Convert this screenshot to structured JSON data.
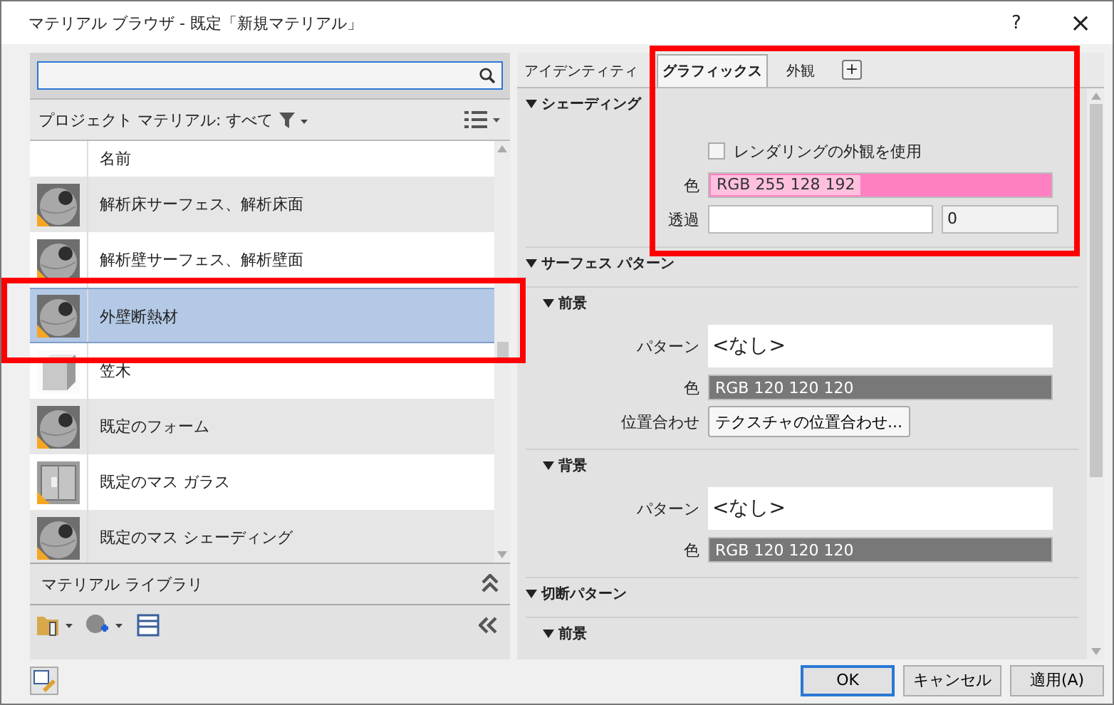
{
  "window": {
    "title": "マテリアル ブラウザ - 既定「新規マテリアル」",
    "help": "?",
    "close": "×"
  },
  "browser": {
    "filter_label": "プロジェクト マテリアル: すべて",
    "column": "名前",
    "rows": [
      {
        "name": "解析床サーフェス、解析床面",
        "kind": "sphere",
        "warning": true,
        "selected": false
      },
      {
        "name": "解析壁サーフェス、解析壁面",
        "kind": "sphere",
        "warning": true,
        "selected": false
      },
      {
        "name": "外壁断熱材",
        "kind": "sphere",
        "warning": true,
        "selected": true
      },
      {
        "name": "笠木",
        "kind": "box",
        "warning": false,
        "selected": false
      },
      {
        "name": "既定のフォーム",
        "kind": "sphere",
        "warning": true,
        "selected": false
      },
      {
        "name": "既定のマス ガラス",
        "kind": "glass",
        "warning": true,
        "selected": false
      },
      {
        "name": "既定のマス シェーディング",
        "kind": "sphere",
        "warning": true,
        "selected": false
      }
    ],
    "library_label": "マテリアル ライブラリ"
  },
  "tabs": [
    {
      "label": "アイデンティティ",
      "selected": false
    },
    {
      "label": "グラフィックス",
      "selected": true
    },
    {
      "label": "外観",
      "selected": false
    }
  ],
  "add_tab": "+",
  "shading": {
    "title": "シェーディング",
    "expanded": true,
    "use_render": {
      "label": "レンダリングの外観を使用",
      "checked": false
    },
    "color": {
      "label": "色",
      "value": "RGB 255 128 192",
      "color": "#ff80c0"
    },
    "transparency": {
      "label": "透過",
      "value": "0"
    }
  },
  "surface_pattern": {
    "title": "サーフェス パターン",
    "expanded": true,
    "groups": [
      {
        "title": "前景",
        "expanded": true,
        "pattern": {
          "label": "パターン",
          "value": "<なし>"
        },
        "color": {
          "label": "色",
          "value": "RGB 120 120 120",
          "color": "#787878"
        },
        "alignment": {
          "label": "位置合わせ",
          "button": "テクスチャの位置合わせ..."
        }
      },
      {
        "title": "背景",
        "expanded": true,
        "pattern": {
          "label": "パターン",
          "value": "<なし>"
        },
        "color": {
          "label": "色",
          "value": "RGB 120 120 120",
          "color": "#787878"
        }
      }
    ]
  },
  "cut_pattern": {
    "title": "切断パターン",
    "expanded": true,
    "groups": [
      {
        "title": "前景",
        "expanded": true
      }
    ]
  },
  "buttons": [
    {
      "label": "OK",
      "default": true
    },
    {
      "label": "キャンセル",
      "default": false
    },
    {
      "label": "適用(A)",
      "default": false
    }
  ]
}
